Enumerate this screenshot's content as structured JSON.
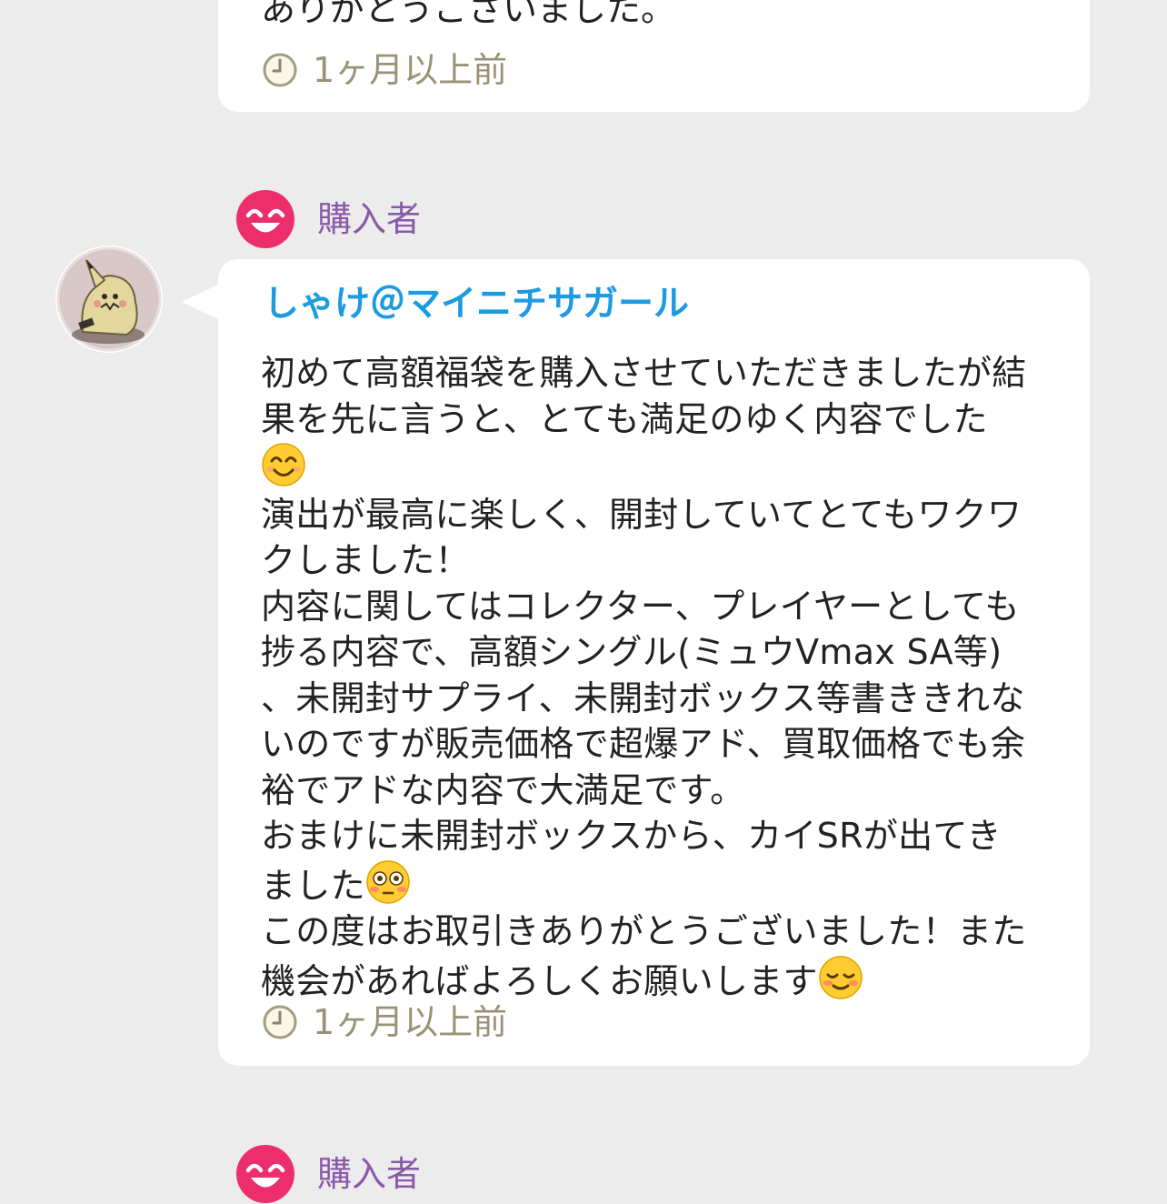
{
  "top_review": {
    "text_tail": "ありがとうございました。",
    "timestamp": "1ヶ月以上前"
  },
  "main_review": {
    "role_label": "購入者",
    "user_name": "しゃけ＠マイニチサガール",
    "body": [
      "初めて高額福袋を購入させていただきましたが結",
      "果を先に言うと、とても満足のゆく内容でした",
      "{emoji:smile}",
      "演出が最高に楽しく、開封していてとてもワクワ",
      "クしました！",
      "内容に関してはコレクター、プレイヤーとしても",
      "捗る内容で、高額シングル(ミュウVmax SA等)",
      "、未開封サプライ、未開封ボックス等書ききれな",
      "いのですが販売価格で超爆アド、買取価格でも余",
      "裕でアドな内容で大満足です。",
      "おまけに未開封ボックスから、カイSRが出てき",
      "ました{emoji:flushed}",
      "この度はお取引きありがとうございました！また",
      "機会があればよろしくお願いします{emoji:relieved}"
    ],
    "timestamp": "1ヶ月以上前"
  },
  "next_review": {
    "role_label": "購入者"
  },
  "icons": {
    "clock": "clock-icon",
    "role": "smiley-face-icon",
    "avatar": "mimikyu-avatar"
  },
  "colors": {
    "background": "#ececec",
    "card": "#ffffff",
    "role_label": "#8a5aa8",
    "user_name": "#1d9be0",
    "timestamp": "#9a9275",
    "role_icon": "#ec2f6c"
  }
}
